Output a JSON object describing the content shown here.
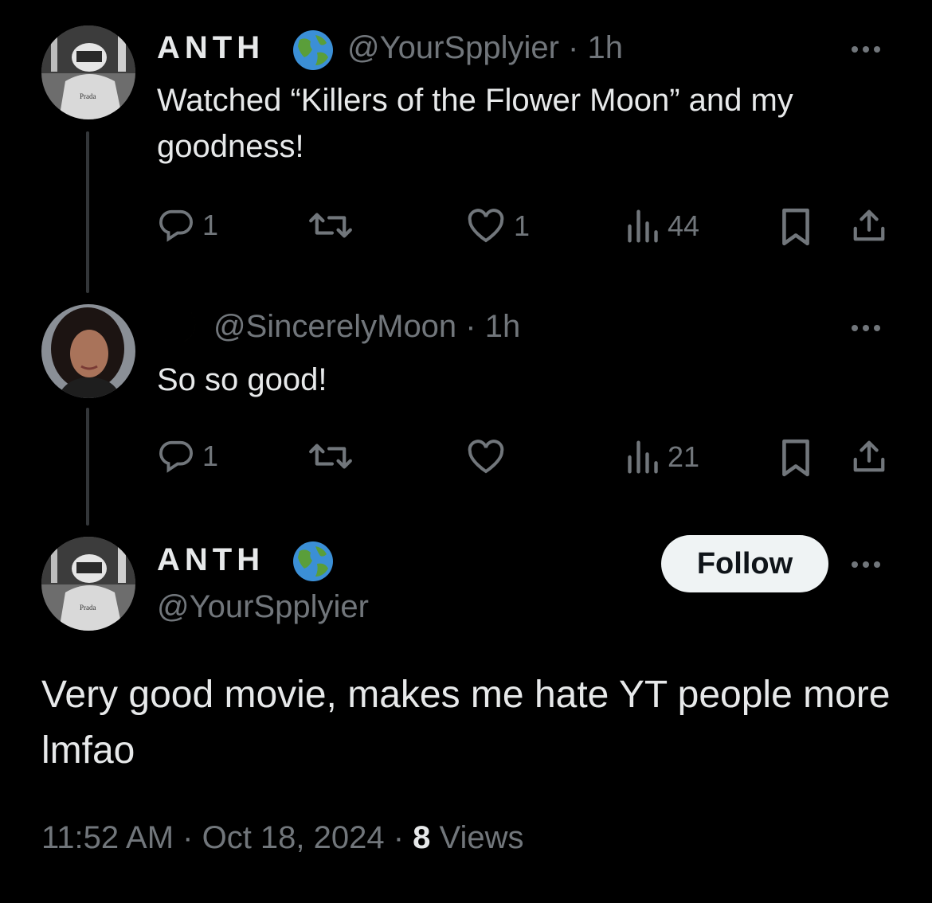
{
  "tweet1": {
    "display_name": "ANTH",
    "name_emoji": "🌎",
    "handle_time": "@YourSpplyier · 1h",
    "text": "Watched “Killers of the Flower Moon” and my goodness!",
    "replies": "1",
    "retweets": "",
    "likes": "1",
    "views": "44"
  },
  "tweet2": {
    "name_emoji": "🌙",
    "handle_time": "@SincerelyMoon · 1h",
    "text": "So so good!",
    "replies": "1",
    "retweets": "",
    "likes": "",
    "views": "21"
  },
  "main_tweet": {
    "display_name": "ANTH",
    "name_emoji": "🌎",
    "handle": "@YourSpplyier",
    "follow_label": "Follow",
    "text": "Very good movie, makes me hate YT people more lmfao",
    "time_date": "11:52 AM · Oct 18, 2024 · ",
    "views_count": "8",
    "views_label": "Views"
  },
  "icons": [
    "reply-icon",
    "retweet-icon",
    "like-icon",
    "views-icon",
    "bookmark-icon",
    "share-icon",
    "more-icon"
  ],
  "colors": {
    "background": "#000000",
    "primary_text": "#e7e9ea",
    "secondary_text": "#71767b",
    "follow_bg": "#eff3f4"
  }
}
